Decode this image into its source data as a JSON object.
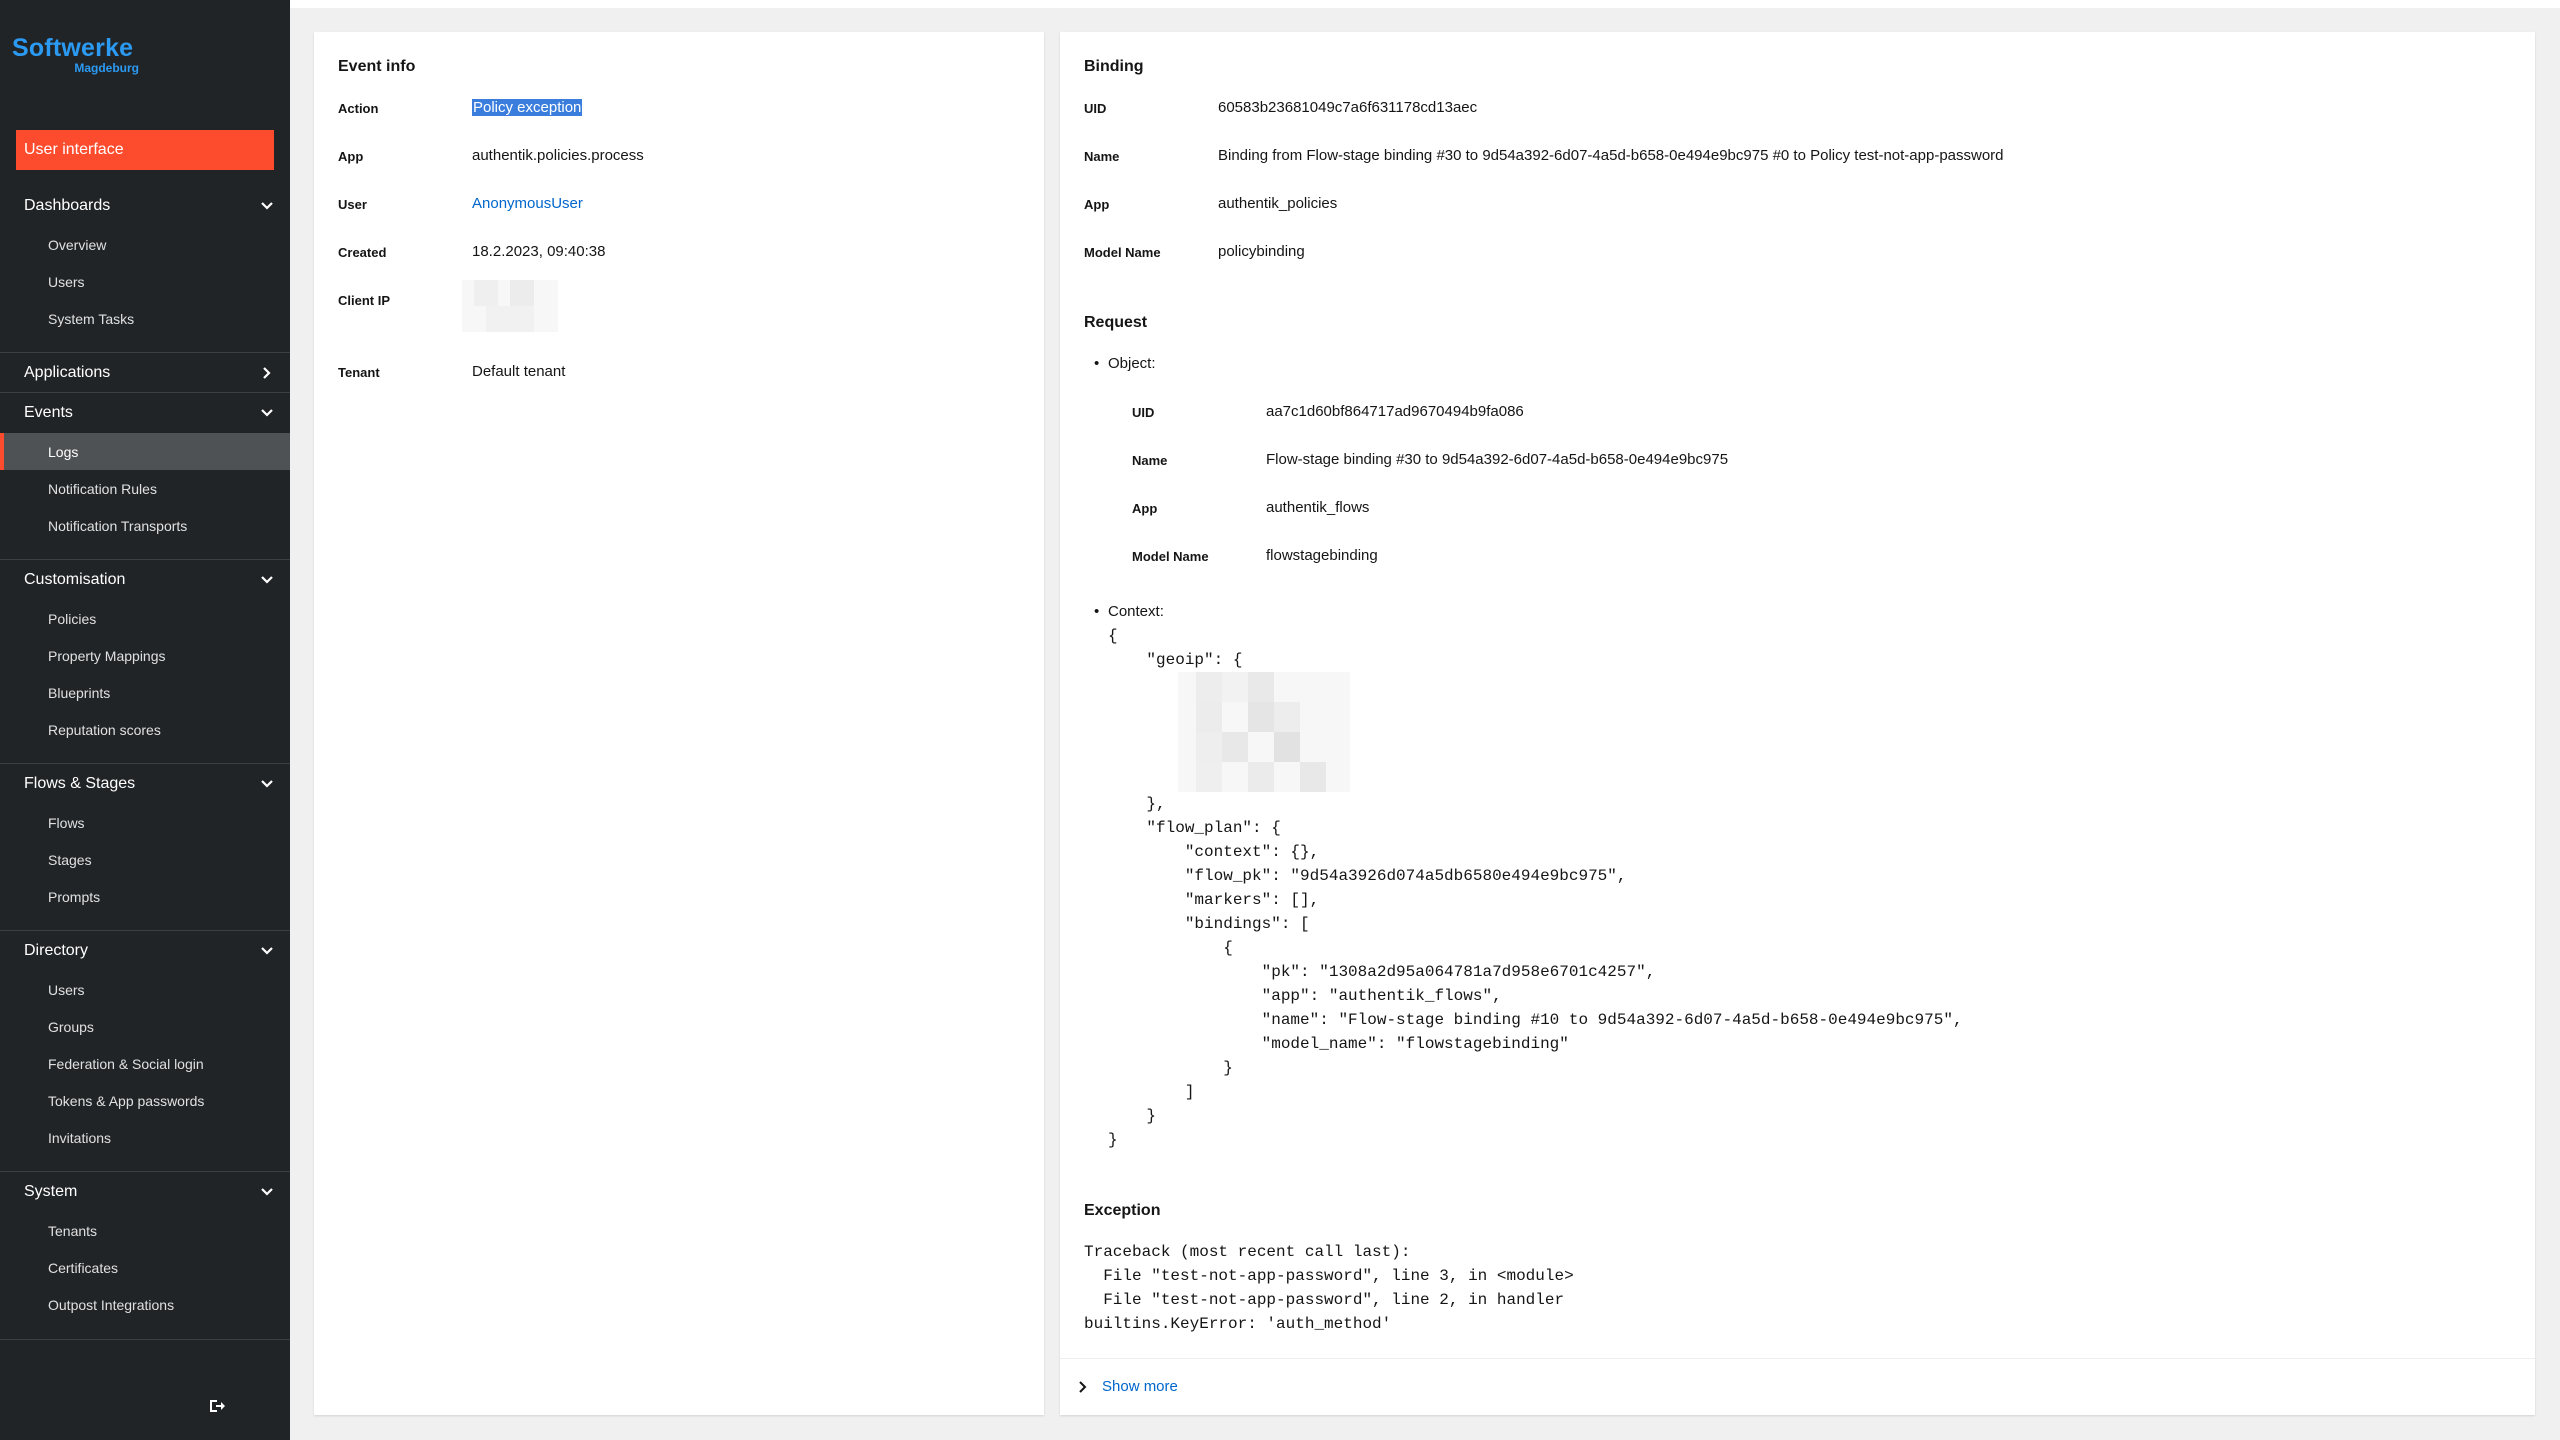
{
  "brand": {
    "name": "Softwerke",
    "sub": "Magdeburg",
    "color": "#2b9af3"
  },
  "sidebar": {
    "ui_button": "User interface",
    "groups": [
      {
        "label": "Dashboards",
        "expanded": true,
        "items": [
          "Overview",
          "Users",
          "System Tasks"
        ]
      },
      {
        "label": "Applications",
        "expanded": false,
        "items": []
      },
      {
        "label": "Events",
        "expanded": true,
        "items": [
          "Logs",
          "Notification Rules",
          "Notification Transports"
        ],
        "active": "Logs"
      },
      {
        "label": "Customisation",
        "expanded": true,
        "items": [
          "Policies",
          "Property Mappings",
          "Blueprints",
          "Reputation scores"
        ]
      },
      {
        "label": "Flows & Stages",
        "expanded": true,
        "items": [
          "Flows",
          "Stages",
          "Prompts"
        ]
      },
      {
        "label": "Directory",
        "expanded": true,
        "items": [
          "Users",
          "Groups",
          "Federation & Social login",
          "Tokens & App passwords",
          "Invitations"
        ]
      },
      {
        "label": "System",
        "expanded": true,
        "items": [
          "Tenants",
          "Certificates",
          "Outpost Integrations"
        ]
      }
    ],
    "logout_icon": "logout-icon"
  },
  "event_info": {
    "title": "Event info",
    "action_label": "Action",
    "action_value": "Policy exception",
    "app_label": "App",
    "app_value": "authentik.policies.process",
    "user_label": "User",
    "user_value": "AnonymousUser",
    "created_label": "Created",
    "created_value": "18.2.2023, 09:40:38",
    "client_ip_label": "Client IP",
    "tenant_label": "Tenant",
    "tenant_value": "Default tenant"
  },
  "binding": {
    "title": "Binding",
    "uid_label": "UID",
    "uid_value": "60583b23681049c7a6f631178cd13aec",
    "name_label": "Name",
    "name_value": "Binding from Flow-stage binding #30 to 9d54a392-6d07-4a5d-b658-0e494e9bc975 #0 to Policy test-not-app-password",
    "app_label": "App",
    "app_value": "authentik_policies",
    "model_label": "Model Name",
    "model_value": "policybinding"
  },
  "request": {
    "title": "Request",
    "object_label": "Object:",
    "uid_label": "UID",
    "uid_value": "aa7c1d60bf864717ad9670494b9fa086",
    "name_label": "Name",
    "name_value": "Flow-stage binding #30 to 9d54a392-6d07-4a5d-b658-0e494e9bc975",
    "app_label": "App",
    "app_value": "authentik_flows",
    "model_label": "Model Name",
    "model_value": "flowstagebinding",
    "context_label": "Context:",
    "context_lines": [
      "{",
      "    \"geoip\": {",
      "    },",
      "    \"flow_plan\": {",
      "        \"context\": {},",
      "        \"flow_pk\": \"9d54a3926d074a5db6580e494e9bc975\",",
      "        \"markers\": [],",
      "        \"bindings\": [",
      "            {",
      "                \"pk\": \"1308a2d95a064781a7d958e6701c4257\",",
      "                \"app\": \"authentik_flows\",",
      "                \"name\": \"Flow-stage binding #10 to 9d54a392-6d07-4a5d-b658-0e494e9bc975\",",
      "                \"model_name\": \"flowstagebinding\"",
      "            }",
      "        ]",
      "    }",
      "}"
    ]
  },
  "exception": {
    "title": "Exception",
    "lines": [
      "Traceback (most recent call last):",
      "  File \"test-not-app-password\", line 3, in <module>",
      "  File \"test-not-app-password\", line 2, in handler",
      "builtins.KeyError: 'auth_method'"
    ]
  },
  "show_more": "Show more",
  "colors": {
    "accent": "#fd4b2d",
    "link": "#0066cc",
    "sidebar_bg": "#212427",
    "selection": "#3b7ddd"
  }
}
